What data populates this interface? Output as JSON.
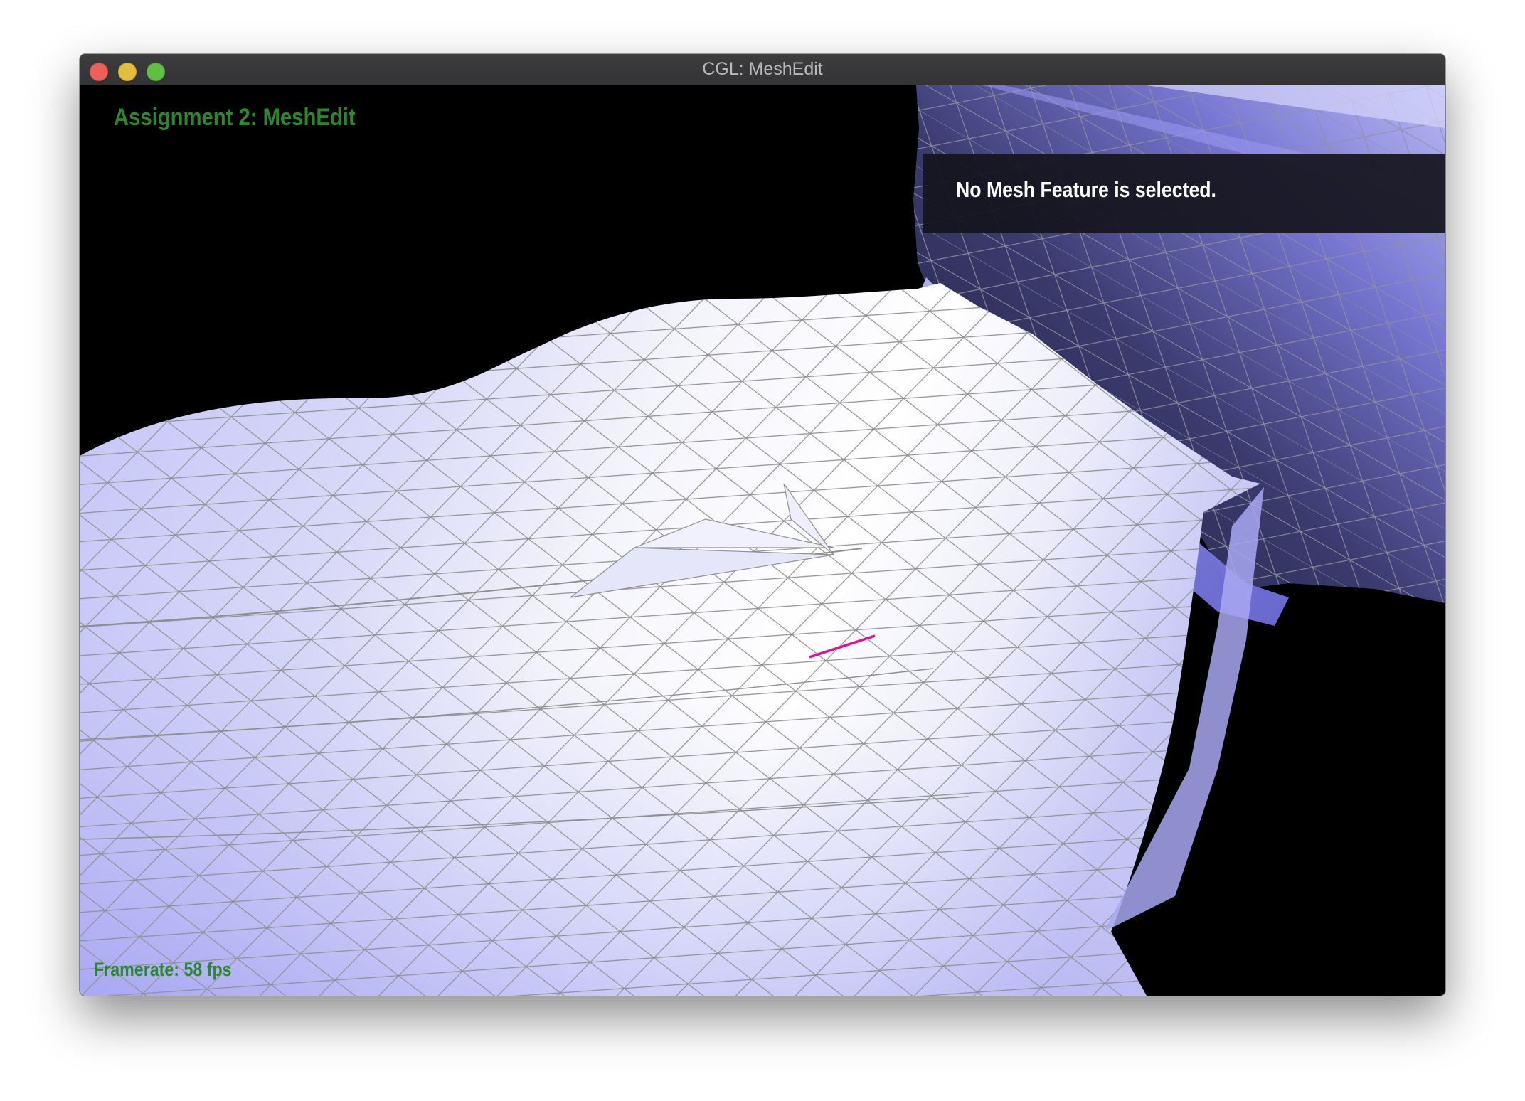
{
  "window": {
    "title": "CGL: MeshEdit"
  },
  "overlay": {
    "app_title": "Assignment 2: MeshEdit",
    "selection_info": "No Mesh Feature is selected.",
    "framerate": "Framerate: 58 fps"
  },
  "colors": {
    "label_green": "#2a8a2a",
    "selected_edge": "#e0109a",
    "mesh_wire": "#8f8f8f",
    "background": "#000000"
  },
  "icons": {
    "close": "close-icon",
    "minimize": "minimize-icon",
    "maximize": "maximize-icon"
  }
}
